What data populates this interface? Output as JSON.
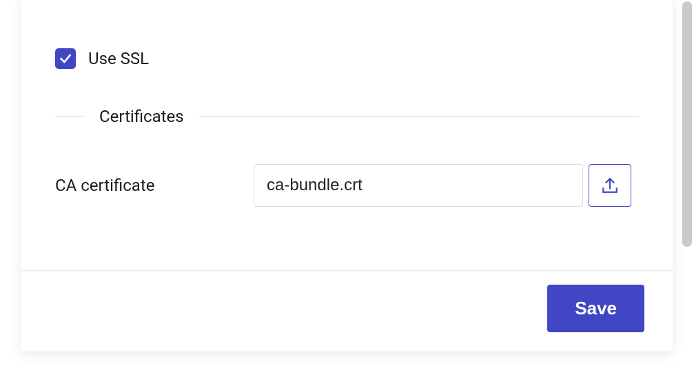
{
  "ssl": {
    "use_ssl_label": "Use SSL",
    "use_ssl_checked": true,
    "section_title": "Certificates",
    "ca_cert_label": "CA certificate",
    "ca_cert_value": "ca-bundle.crt"
  },
  "footer": {
    "save_label": "Save"
  },
  "colors": {
    "accent": "#4147c4"
  }
}
